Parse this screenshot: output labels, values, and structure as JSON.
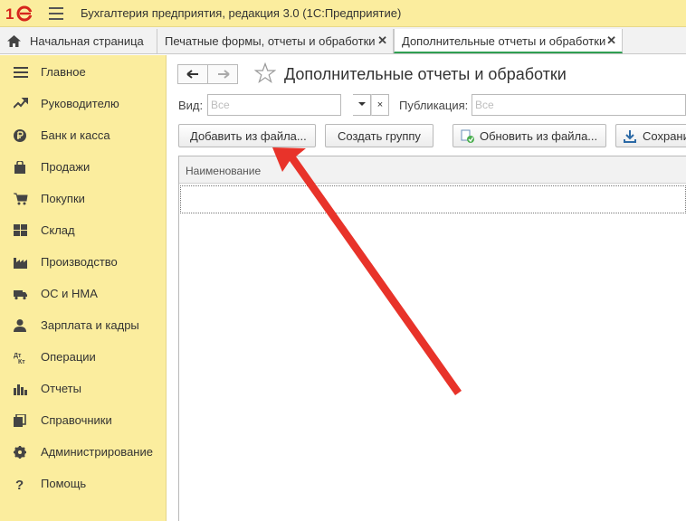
{
  "app": {
    "title": "Бухгалтерия предприятия, редакция 3.0  (1С:Предприятие)",
    "logo_text": "1С"
  },
  "tabs": [
    {
      "label": "Начальная страница",
      "closable": false,
      "active": false
    },
    {
      "label": "Печатные формы, отчеты и обработки",
      "closable": true,
      "active": false
    },
    {
      "label": "Дополнительные отчеты и обработки",
      "closable": true,
      "active": true
    }
  ],
  "tab_close_glyph": "✕",
  "sidebar": {
    "items": [
      {
        "label": "Главное",
        "icon": "menu-lines-icon"
      },
      {
        "label": "Руководителю",
        "icon": "trend-icon"
      },
      {
        "label": "Банк и касса",
        "icon": "ruble-coin-icon"
      },
      {
        "label": "Продажи",
        "icon": "shopping-bag-icon"
      },
      {
        "label": "Покупки",
        "icon": "cart-icon"
      },
      {
        "label": "Склад",
        "icon": "warehouse-grid-icon"
      },
      {
        "label": "Производство",
        "icon": "factory-icon"
      },
      {
        "label": "ОС и НМА",
        "icon": "truck-icon"
      },
      {
        "label": "Зарплата и кадры",
        "icon": "person-icon"
      },
      {
        "label": "Операции",
        "icon": "dt-kt-icon"
      },
      {
        "label": "Отчеты",
        "icon": "bar-chart-icon"
      },
      {
        "label": "Справочники",
        "icon": "books-icon"
      },
      {
        "label": "Администрирование",
        "icon": "gear-icon"
      },
      {
        "label": "Помощь",
        "icon": "question-icon"
      }
    ]
  },
  "main": {
    "title": "Дополнительные отчеты и обработки",
    "filters": {
      "vid_label": "Вид:",
      "vid_placeholder": "Все",
      "publication_label": "Публикация:",
      "publication_placeholder": "Все"
    },
    "buttons": {
      "add_from_file": "Добавить из файла...",
      "create_group": "Создать группу",
      "update_from_file": "Обновить из файла...",
      "save": "Сохрани"
    },
    "table": {
      "columns": [
        "Наименование"
      ],
      "rows": []
    }
  },
  "colors": {
    "sidebar_bg": "#fbed9e",
    "active_tab_underline": "#2f9f52",
    "annotation_arrow": "#e8332a"
  }
}
